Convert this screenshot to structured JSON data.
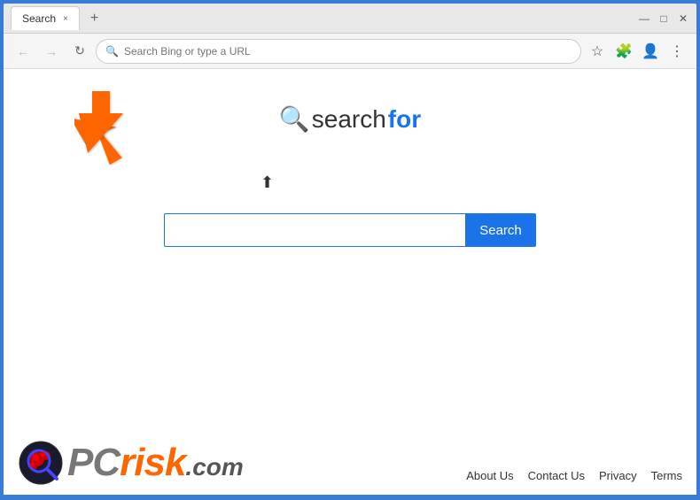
{
  "browser": {
    "tab_title": "Search",
    "tab_close_label": "×",
    "tab_new_label": "+",
    "address_placeholder": "Search Bing or type a URL",
    "win_minimize": "—",
    "win_maximize": "□",
    "win_close": "✕"
  },
  "nav": {
    "back_icon": "←",
    "forward_icon": "→",
    "refresh_icon": "↻",
    "address_search_icon": "🔍",
    "favorites_icon": "☆",
    "extensions_icon": "🧩",
    "profile_icon": "👤",
    "more_icon": "⋮"
  },
  "logo": {
    "icon": "🔍",
    "text_search": "search",
    "text_for": "for"
  },
  "search": {
    "input_placeholder": "",
    "button_label": "Search"
  },
  "footer": {
    "pcrisk_text_pc": "PC",
    "pcrisk_text_risk": "risk",
    "pcrisk_text_domain": ".com",
    "links": [
      {
        "label": "About Us"
      },
      {
        "label": "Contact Us"
      },
      {
        "label": "Privacy"
      },
      {
        "label": "Terms"
      }
    ]
  }
}
